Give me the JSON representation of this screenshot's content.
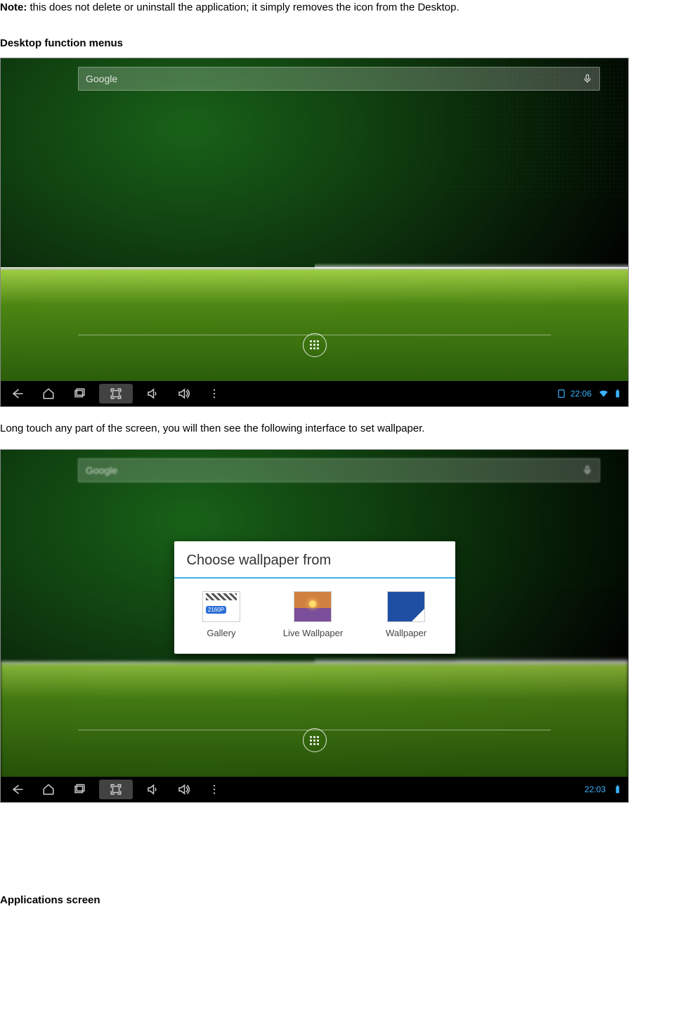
{
  "note": {
    "label": "Note:",
    "text": " this does not delete or uninstall the application; it simply removes the icon from the Desktop."
  },
  "headings": {
    "desktop_menus": "Desktop function menus",
    "applications": "Applications screen"
  },
  "caption_longpress": "Long touch any part of the screen, you will then see the following interface to set wallpaper.",
  "screenshot1": {
    "search_placeholder": "Google",
    "time": "22:06"
  },
  "screenshot2": {
    "search_placeholder": "Google",
    "time": "22:03",
    "dialog_title": "Choose wallpaper from",
    "options": {
      "gallery": "Gallery",
      "live": "Live Wallpaper",
      "wallpaper": "Wallpaper"
    }
  }
}
